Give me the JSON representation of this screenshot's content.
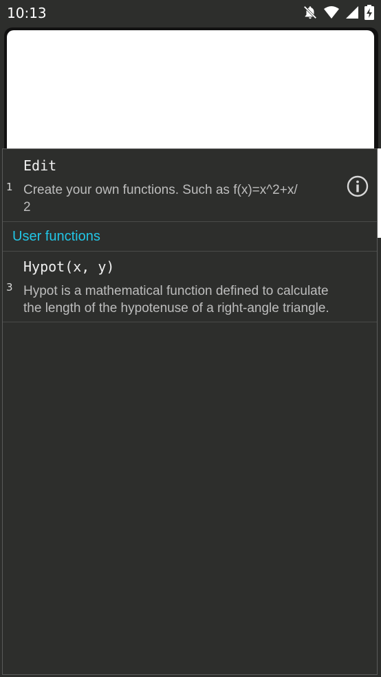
{
  "status_bar": {
    "time": "10:13",
    "icons": [
      "notifications-off-icon",
      "wifi-icon",
      "signal-icon",
      "battery-charging-icon"
    ]
  },
  "editor": {
    "content": ""
  },
  "function_list": {
    "edit_item": {
      "index": "1",
      "title": "Edit",
      "description": "Create your own functions. Such as f(x)=x^2+x/2",
      "description_line1": "Create your own functions. Such as f(x)=x^2+x/",
      "description_line2": "2",
      "icon": "info-icon"
    },
    "section_header": "User functions",
    "items": [
      {
        "index": "3",
        "title": "Hypot(x, y)",
        "description_line1": "Hypot is a mathematical function defined to calculate",
        "description_line2": "the length of the hypotenuse of a right-angle triangle."
      }
    ]
  },
  "colors": {
    "background": "#2d2e2c",
    "accent": "#22c6e6",
    "title_text": "#f0f0f0",
    "description_text": "#bdbdbd"
  }
}
